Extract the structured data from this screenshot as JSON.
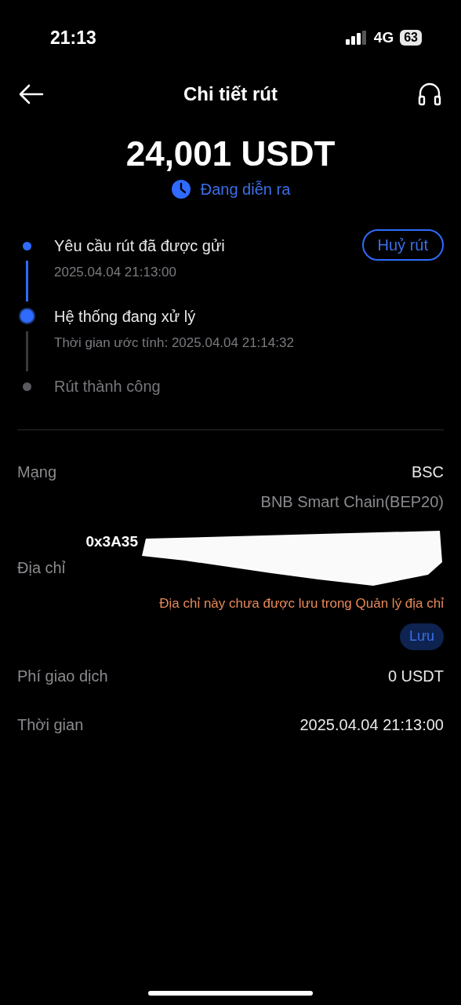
{
  "status_bar": {
    "time": "21:13",
    "network": "4G",
    "battery": "63"
  },
  "header": {
    "title": "Chi tiết rút"
  },
  "amount": "24,001 USDT",
  "status": "Đang diễn ra",
  "timeline": [
    {
      "title": "Yêu cầu rút đã được gửi",
      "subtitle": "2025.04.04 21:13:00",
      "done": true,
      "current": false
    },
    {
      "title": "Hệ thống đang xử lý",
      "subtitle": "Thời gian ước tính: 2025.04.04 21:14:32",
      "done": false,
      "current": true
    },
    {
      "title": "Rút thành công",
      "done": false,
      "current": false
    }
  ],
  "cancel_button": "Huỷ rút",
  "network": {
    "label": "Mạng",
    "value": "BSC",
    "detail": "BNB Smart Chain(BEP20)"
  },
  "address": {
    "label": "Địa chỉ",
    "value": "0x3A35",
    "warning": "Địa chỉ này chưa được lưu trong Quản lý địa chỉ",
    "save_button": "Lưu"
  },
  "details": [
    {
      "label": "Phí giao dịch",
      "value": "0 USDT"
    },
    {
      "label": "Thời gian",
      "value": "2025.04.04 21:13:00"
    }
  ]
}
